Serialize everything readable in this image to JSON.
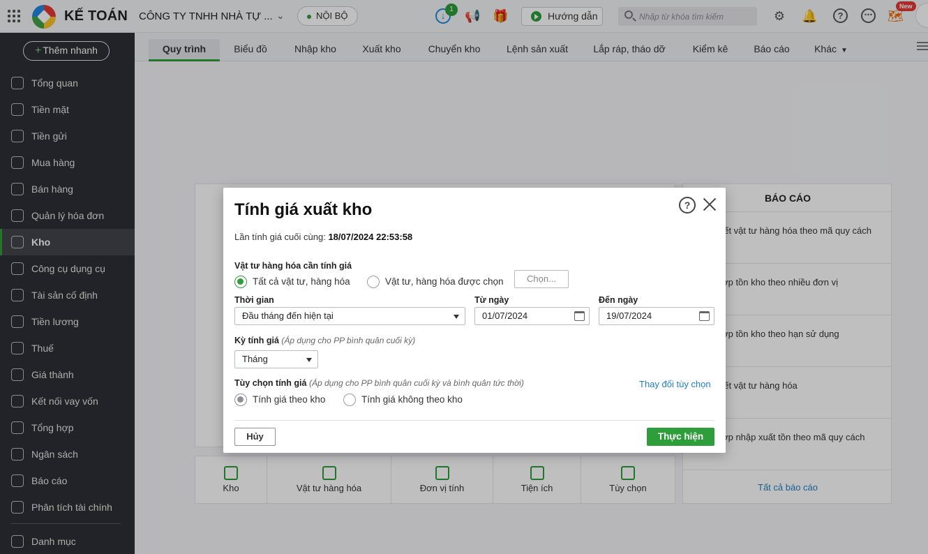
{
  "topbar": {
    "brand": "KẾ TOÁN",
    "company": "CÔNG TY TNHH NHÀ TỰ ...",
    "env": "NỘI BỘ",
    "download_badge": "1",
    "guide_label": "Hướng dẫn",
    "search_placeholder": "Nhập từ khóa tìm kiếm",
    "new_badge": "New"
  },
  "sidebar": {
    "quick_add": "Thêm nhanh",
    "items": [
      {
        "label": "Tổng quan",
        "icon": "dashboard-icon"
      },
      {
        "label": "Tiền mặt",
        "icon": "money-bag-icon"
      },
      {
        "label": "Tiền gửi",
        "icon": "bank-icon"
      },
      {
        "label": "Mua hàng",
        "icon": "shopping-bag-icon"
      },
      {
        "label": "Bán hàng",
        "icon": "cart-icon"
      },
      {
        "label": "Quản lý hóa đơn",
        "icon": "invoice-icon"
      },
      {
        "label": "Kho",
        "icon": "warehouse-icon"
      },
      {
        "label": "Công cụ dụng cụ",
        "icon": "tools-icon"
      },
      {
        "label": "Tài sản cố định",
        "icon": "car-icon"
      },
      {
        "label": "Tiền lương",
        "icon": "payroll-icon"
      },
      {
        "label": "Thuế",
        "icon": "tax-icon"
      },
      {
        "label": "Giá thành",
        "icon": "price-tag-icon"
      },
      {
        "label": "Kết nối vay vốn",
        "icon": "loan-icon"
      },
      {
        "label": "Tổng hợp",
        "icon": "summary-icon"
      },
      {
        "label": "Ngân sách",
        "icon": "budget-icon"
      },
      {
        "label": "Báo cáo",
        "icon": "bar-chart-icon"
      },
      {
        "label": "Phân tích tài chính",
        "icon": "analytics-icon"
      },
      {
        "label": "Danh mục",
        "icon": "list-icon"
      }
    ],
    "active": "Kho"
  },
  "tabs": [
    "Quy trình",
    "Biểu đồ",
    "Nhập kho",
    "Xuất kho",
    "Chuyển kho",
    "Lệnh sản xuất",
    "Lắp ráp, tháo dỡ",
    "Kiểm kê",
    "Báo cáo",
    "Khác"
  ],
  "reports": {
    "title": "BÁO CÁO",
    "items": [
      "hi tiết vật tư hàng hóa theo mã quy cách",
      "g hợp tồn kho theo nhiều đơn vị",
      "g hợp tồn kho theo hạn sử dụng",
      "hi tiết vật tư hàng hóa",
      "g hợp nhập xuất tồn theo mã quy cách"
    ],
    "all": "Tất cả báo cáo"
  },
  "quick_links": [
    "Kho",
    "Vật tư hàng hóa",
    "Đơn vị tính",
    "Tiện ích",
    "Tùy chọn"
  ],
  "dialog": {
    "title": "Tính giá xuất kho",
    "last_calc_label": "Lần tính giá cuối cùng:",
    "last_calc_value": "18/07/2024 22:53:58",
    "materials_label": "Vật tư hàng hóa cần tính giá",
    "opt_all": "Tất cả vật tư, hàng hóa",
    "opt_selected": "Vật tư, hàng hóa được chọn",
    "choose_btn": "Chọn...",
    "time_label": "Thời gian",
    "time_value": "Đầu tháng đến hiện tại",
    "from_label": "Từ ngày",
    "from_value": "01/07/2024",
    "to_label": "Đến ngày",
    "to_value": "19/07/2024",
    "period_label": "Kỳ tính giá",
    "period_note": "(Áp dụng cho PP bình quân cuối kỳ)",
    "period_value": "Tháng",
    "option_label": "Tùy chọn tính giá",
    "option_note": "(Áp dụng cho PP bình quân cuối kỳ và bình quân tức thời)",
    "change_link": "Thay đổi tùy chọn",
    "opt_by_wh": "Tính giá theo kho",
    "opt_not_wh": "Tính giá không theo kho",
    "cancel": "Hủy",
    "run": "Thực hiện"
  }
}
